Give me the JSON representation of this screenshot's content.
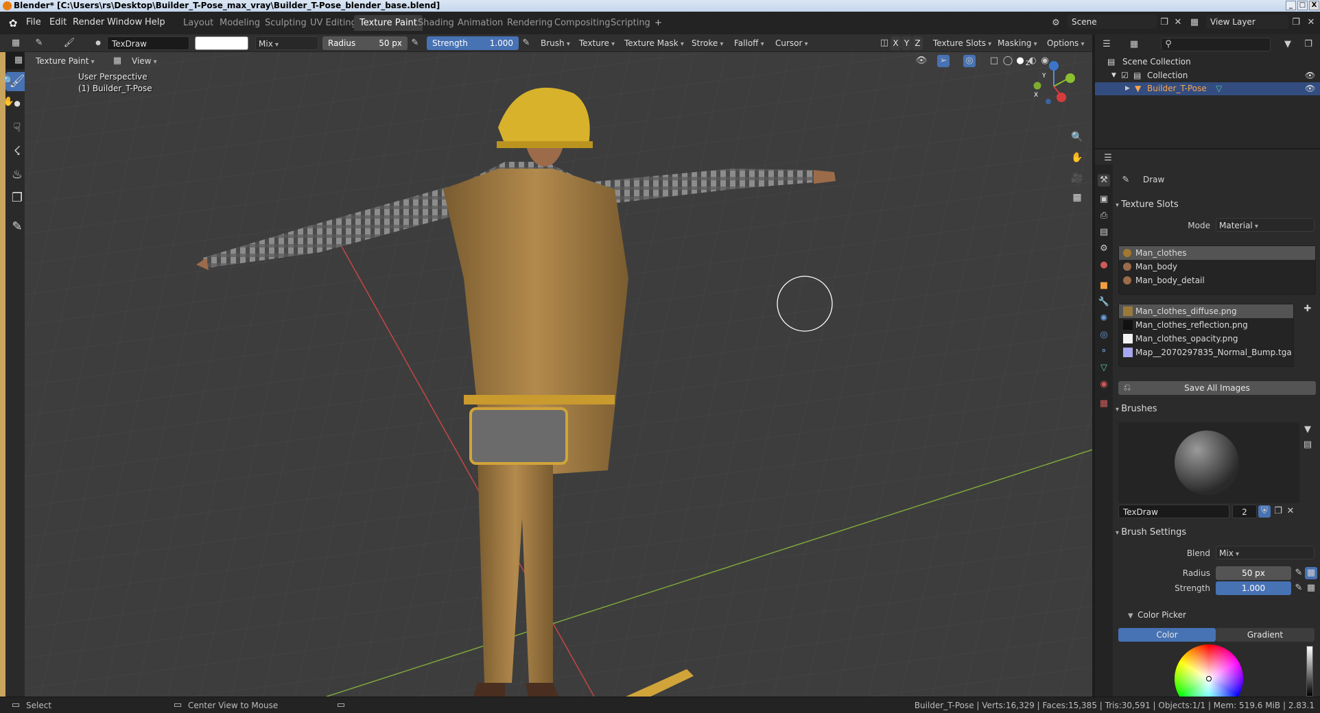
{
  "window": {
    "title": "Blender* [C:\\Users\\rs\\Desktop\\Builder_T-Pose_max_vray\\Builder_T-Pose_blender_base.blend]",
    "min": "_",
    "max": "□",
    "close": "X"
  },
  "menus": [
    "File",
    "Edit",
    "Render",
    "Window",
    "Help"
  ],
  "workspaces": [
    "Layout",
    "Modeling",
    "Sculpting",
    "UV Editing",
    "Texture Paint",
    "Shading",
    "Animation",
    "Rendering",
    "Compositing",
    "Scripting",
    "+"
  ],
  "active_workspace": "Texture Paint",
  "scene": {
    "name": "Scene",
    "view_layer": "View Layer"
  },
  "tool_header": {
    "brush_name": "TexDraw",
    "blend_mode": "Mix",
    "radius_label": "Radius",
    "radius_value": "50 px",
    "strength_label": "Strength",
    "strength_value": "1.000",
    "menus": [
      "Brush",
      "Texture",
      "Texture Mask",
      "Stroke",
      "Falloff",
      "Cursor"
    ],
    "axes": [
      "X",
      "Y",
      "Z"
    ],
    "right_menus": [
      "Texture Slots",
      "Masking",
      "Options"
    ]
  },
  "view_header": {
    "mode": "Texture Paint",
    "view": "View"
  },
  "viewport": {
    "perspective": "User Perspective",
    "object": "(1) Builder_T-Pose",
    "gizmo_axes": [
      "Z",
      "Y",
      "X"
    ]
  },
  "outliner": {
    "root": "Scene Collection",
    "collection": "Collection",
    "object": "Builder_T-Pose"
  },
  "properties": {
    "tool_name": "Draw",
    "texture_slots_title": "Texture Slots",
    "mode_label": "Mode",
    "mode_value": "Material",
    "materials": [
      "Man_clothes",
      "Man_body",
      "Man_body_detail"
    ],
    "images": [
      "Man_clothes_diffuse.png",
      "Man_clothes_reflection.png",
      "Man_clothes_opacity.png",
      "Map__2070297835_Normal_Bump.tga"
    ],
    "save_all": "Save All Images",
    "brushes_title": "Brushes",
    "brush_name": "TexDraw",
    "brush_users": "2",
    "brush_settings_title": "Brush Settings",
    "blend_label": "Blend",
    "blend_value": "Mix",
    "radius_label": "Radius",
    "radius_value": "50 px",
    "strength_label": "Strength",
    "strength_value": "1.000",
    "color_picker_title": "Color Picker",
    "color_tab": "Color",
    "gradient_tab": "Gradient"
  },
  "statusbar": {
    "select": "Select",
    "center": "Center View to Mouse",
    "stats": "Builder_T-Pose | Verts:16,329 | Faces:15,385 | Tris:30,591 | Objects:1/1 | Mem: 519.6 MiB | 2.83.1"
  },
  "colors": {
    "accent": "#4772b3",
    "viewport_bg": "#3d3d3d",
    "selected_object": "#f9a54a",
    "x_axis": "#d63c3c",
    "y_axis": "#8cbf2e"
  }
}
